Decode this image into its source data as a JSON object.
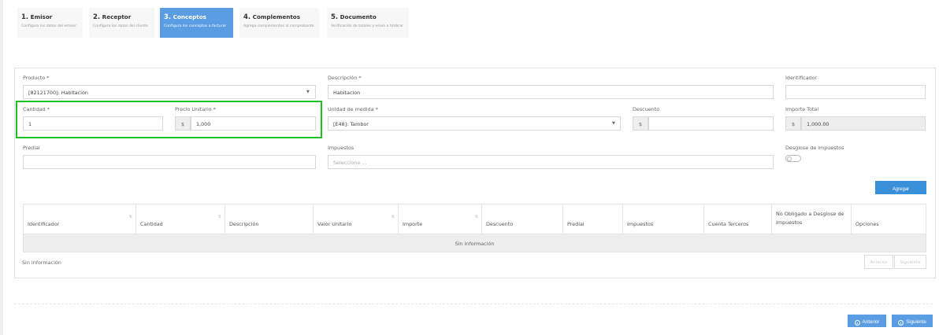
{
  "steps": [
    {
      "num": "1.",
      "title": "Emisor",
      "desc": "Configura los datos del emisor"
    },
    {
      "num": "2.",
      "title": "Receptor",
      "desc": "Configura los datos del cliente"
    },
    {
      "num": "3.",
      "title": "Conceptos",
      "desc": "Configura los conceptos a facturar"
    },
    {
      "num": "4.",
      "title": "Complementos",
      "desc": "Agrega complementos al comprobante"
    },
    {
      "num": "5.",
      "title": "Documento",
      "desc": "Verificación de totales y envío a timbrar"
    }
  ],
  "form": {
    "producto": {
      "label": "Producto *",
      "value": "[82121700]: Habitacion"
    },
    "descripcion": {
      "label": "Descripción *",
      "value": "Habitacion"
    },
    "identificador": {
      "label": "Identificador",
      "value": ""
    },
    "cantidad": {
      "label": "Cantidad *",
      "value": "1"
    },
    "precio_unitario": {
      "label": "Precio Unitario *",
      "prefix": "$",
      "value": "1,000"
    },
    "unidad_medida": {
      "label": "Unidad de medida *",
      "value": "[E48]: Tambor"
    },
    "descuento": {
      "label": "Descuento",
      "prefix": "$",
      "value": ""
    },
    "importe_total": {
      "label": "Importe Total",
      "prefix": "$",
      "value": "1,000.00"
    },
    "predial": {
      "label": "Predial",
      "value": ""
    },
    "impuestos": {
      "label": "Impuestos",
      "placeholder": "Seleccione ..."
    },
    "desglose": {
      "label": "Desglose de impuestos"
    },
    "agregar_label": "Agregar"
  },
  "table": {
    "columns": [
      "Identificador",
      "Cantidad",
      "Descripción",
      "Valor Unitario",
      "Importe",
      "Descuento",
      "Predial",
      "Impuestos",
      "Cuenta Terceros",
      "No Obligado a Desglose de Impuestos",
      "Opciones"
    ],
    "empty_text": "Sin información",
    "footer_text": "Sin información",
    "prev_label": "Anterior",
    "next_label": "Siguiente"
  },
  "nav": {
    "prev_label": "Anterior",
    "next_label": "Siguiente"
  },
  "colors": {
    "accent": "#5b9de2",
    "button": "#3a8fd9",
    "highlight": "#1ec21e"
  }
}
